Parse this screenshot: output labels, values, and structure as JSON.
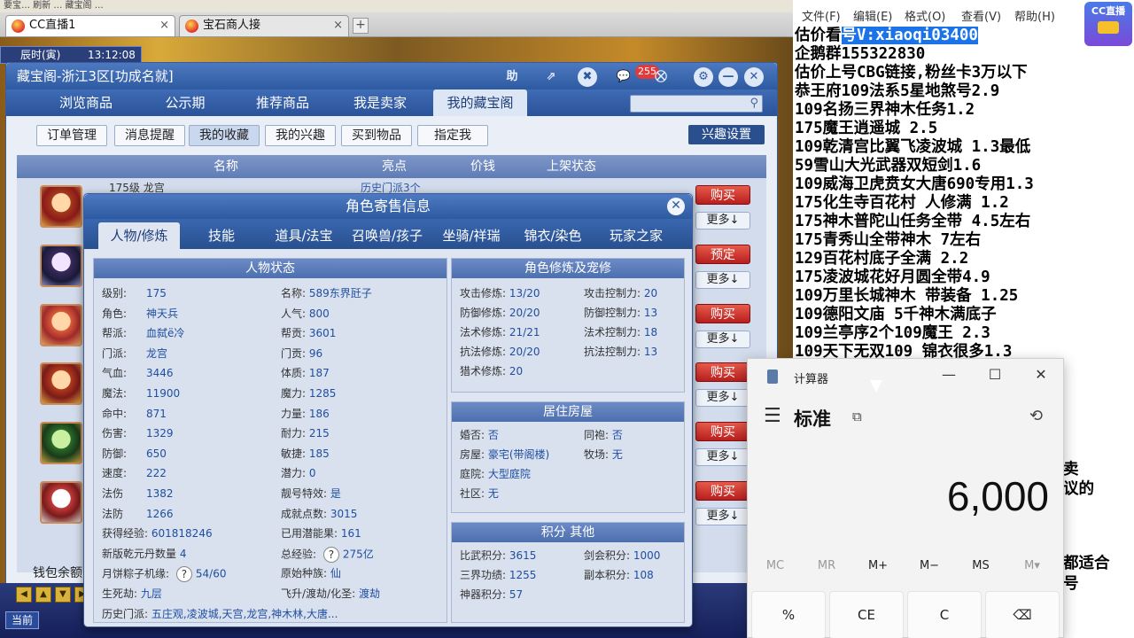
{
  "browser": {
    "top_strip": "要宝… 刷新 … 藏宝阁 …",
    "tabs": [
      {
        "label": "CC直播1",
        "active": true
      },
      {
        "label": "宝石商人接",
        "active": false
      }
    ],
    "new_tab": "+"
  },
  "game": {
    "clock_label": "辰时(寅)",
    "clock_time": "13:12:08",
    "window_title": "藏宝阁-浙江3区[功成名就]",
    "title_icons": [
      "助",
      "⇗",
      "✖",
      "💬",
      "⛒",
      "⚙",
      "✕"
    ],
    "msg_count": "255",
    "nav": [
      "浏览商品",
      "公示期",
      "推荐商品",
      "我是卖家",
      "我的藏宝阁"
    ],
    "subnav": [
      "订单管理",
      "消息提醒",
      "我的收藏",
      "我的兴趣",
      "买到物品",
      "指定我"
    ],
    "interest_btn": "兴趣设置",
    "table_headers": [
      "名称",
      "亮点",
      "价钱",
      "上架状态"
    ],
    "row_buttons": [
      {
        "main": "购买",
        "more": "更多↓"
      },
      {
        "main": "预定",
        "more": "更多↓"
      },
      {
        "main": "购买",
        "more": "更多↓"
      },
      {
        "main": "购买",
        "more": "更多↓"
      },
      {
        "main": "购买",
        "more": "更多↓"
      },
      {
        "main": "购买",
        "more": "更多↓"
      }
    ],
    "first_row_partial": "175级 龙宫",
    "first_row_highlight": "历史门派3个",
    "wallet_label": "钱包余额",
    "bottom_button": "当前",
    "bottom_arrows": [
      "◀",
      "▲",
      "▼",
      "▶"
    ]
  },
  "dialog": {
    "title": "角色寄售信息",
    "close": "✕",
    "tabs": [
      "人物/修炼",
      "技能",
      "道具/法宝",
      "召唤兽/孩子",
      "坐骑/祥瑞",
      "锦衣/染色",
      "玩家之家"
    ],
    "status_header": "人物状态",
    "status_left": [
      {
        "k": "级别:",
        "v": "175"
      },
      {
        "k": "角色:",
        "v": "神天兵"
      },
      {
        "k": "帮派:",
        "v": "血弑ё冷"
      },
      {
        "k": "门派:",
        "v": "龙宫"
      },
      {
        "k": "气血:",
        "v": "3446"
      },
      {
        "k": "魔法:",
        "v": "11900"
      },
      {
        "k": "命中:",
        "v": "871"
      },
      {
        "k": "伤害:",
        "v": "1329"
      },
      {
        "k": "防御:",
        "v": "650"
      },
      {
        "k": "速度:",
        "v": "222"
      },
      {
        "k": "法伤",
        "v": "1382"
      },
      {
        "k": "法防",
        "v": "1266"
      },
      {
        "k": "获得经验:",
        "v": "601818246"
      },
      {
        "k": "新版乾元丹数量",
        "v": "4"
      },
      {
        "k": "月饼粽子机缘:",
        "v": "54/60"
      },
      {
        "k": "生死劫:",
        "v": "九层"
      },
      {
        "k": "历史门派:",
        "v": "五庄观,凌波城,天宫,龙宫,神木林,大唐..."
      }
    ],
    "status_right": [
      {
        "k": "名称:",
        "v": "589东界瓩子"
      },
      {
        "k": "人气:",
        "v": "800"
      },
      {
        "k": "帮贡:",
        "v": "3601"
      },
      {
        "k": "门贡:",
        "v": "96"
      },
      {
        "k": "体质:",
        "v": "187"
      },
      {
        "k": "魔力:",
        "v": "1285"
      },
      {
        "k": "力量:",
        "v": "186"
      },
      {
        "k": "耐力:",
        "v": "215"
      },
      {
        "k": "敏捷:",
        "v": "185"
      },
      {
        "k": "潜力:",
        "v": "0"
      },
      {
        "k": "靓号特效:",
        "v": "是"
      },
      {
        "k": "成就点数:",
        "v": "3015"
      },
      {
        "k": "已用潜能果:",
        "v": "161"
      },
      {
        "k": "总经验:",
        "v": "275亿"
      },
      {
        "k": "原始种族:",
        "v": "仙"
      },
      {
        "k": "飞升/渡劫/化圣:",
        "v": "渡劫"
      }
    ],
    "cult_header": "角色修炼及宠修",
    "cult": [
      {
        "k": "攻击修炼:",
        "v": "13/20",
        "k2": "攻击控制力:",
        "v2": "20"
      },
      {
        "k": "防御修炼:",
        "v": "20/20",
        "k2": "防御控制力:",
        "v2": "13"
      },
      {
        "k": "法术修炼:",
        "v": "21/21",
        "k2": "法术控制力:",
        "v2": "18"
      },
      {
        "k": "抗法修炼:",
        "v": "20/20",
        "k2": "抗法控制力:",
        "v2": "13"
      },
      {
        "k": "猎术修炼:",
        "v": "20",
        "k2": "",
        "v2": ""
      }
    ],
    "house_header": "居住房屋",
    "house": [
      {
        "k": "婚否:",
        "v": "否",
        "k2": "同袍:",
        "v2": "否"
      },
      {
        "k": "房屋:",
        "v": "豪宅(带阁楼)",
        "k2": "牧场:",
        "v2": "无"
      },
      {
        "k": "庭院:",
        "v": "大型庭院",
        "k2": "",
        "v2": ""
      },
      {
        "k": "社区:",
        "v": "无",
        "k2": "",
        "v2": ""
      }
    ],
    "score_header": "积分 其他",
    "score": [
      {
        "k": "比武积分:",
        "v": "3615",
        "k2": "剑会积分:",
        "v2": "1000"
      },
      {
        "k": "三界功绩:",
        "v": "1255",
        "k2": "副本积分:",
        "v2": "108"
      },
      {
        "k": "神器积分:",
        "v": "57",
        "k2": "",
        "v2": ""
      }
    ]
  },
  "notepad": {
    "menu": [
      "文件(F)",
      "编辑(E)",
      "格式(O)",
      "查看(V)",
      "帮助(H)"
    ],
    "line0_pre": "估价看",
    "line0_hl": "号V:xiaoqi03400",
    "lines": [
      "企鹅群155322830",
      "估价上号CBG链接,粉丝卡3万以下",
      "恭王府109法系5星地煞号2.9",
      "109名扬三界神木任务1.2",
      "175魔王逍遥城 2.5",
      "109乾清宫比翼飞凌波城 1.3最低",
      "59雪山大光武器双短剑1.6",
      "109威海卫虎贲女大唐690专用1.3",
      "175化生寺百花村 人修满 1.2",
      "175神木普陀山任务全带 4.5左右",
      "175青秀山全带神木  7左右",
      "129百花村底子全满 2.2",
      "175凌波城花好月圆全带4.9",
      "109万里长城神木 带装备  1.25",
      "109德阳文庙 5千神木满底子",
      "109兰亭序2个109魔王 2.3",
      "109天下无双109  锦衣很多1.3"
    ],
    "partials": [
      "卖",
      "议的",
      "都适合",
      "号"
    ],
    "cc_logo": "CC直播"
  },
  "calculator": {
    "title": "计算器",
    "window_controls": [
      "—",
      "☐",
      "✕"
    ],
    "mode": "标准",
    "keep_on_top": "⧉",
    "history_icon": "⟲",
    "menu_icon": "☰",
    "display": "6,000",
    "memory": [
      "MC",
      "MR",
      "M+",
      "M−",
      "MS",
      "M▾"
    ],
    "keys": [
      "%",
      "CE",
      "C",
      "⌫"
    ]
  }
}
